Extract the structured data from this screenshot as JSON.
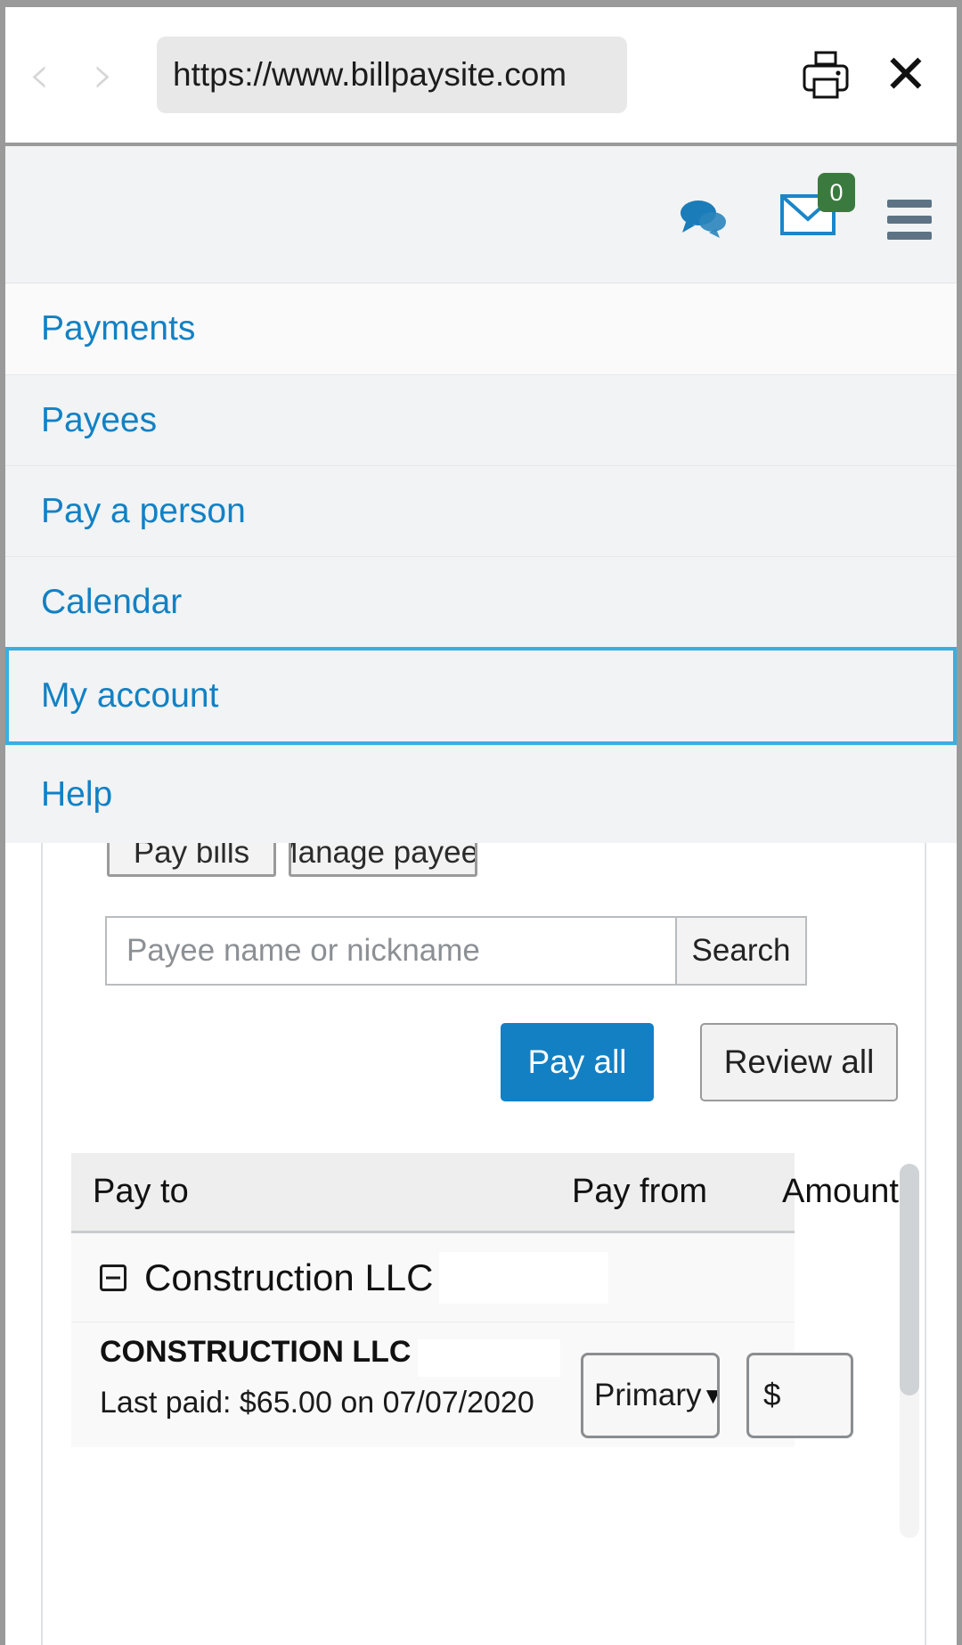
{
  "browser": {
    "back_icon": "chevron-left-icon",
    "forward_icon": "chevron-right-icon",
    "url": "https://www.billpaysite.com",
    "print_icon": "printer-icon",
    "close_icon": "close-icon"
  },
  "utility_bar": {
    "chat_icon": "chat-bubbles-icon",
    "mail_icon": "envelope-icon",
    "mail_badge": "0",
    "menu_icon": "hamburger-menu-icon"
  },
  "nav": {
    "items": [
      {
        "label": "Payments",
        "selected": false
      },
      {
        "label": "Payees",
        "selected": false
      },
      {
        "label": "Pay a person",
        "selected": false
      },
      {
        "label": "Calendar",
        "selected": false
      },
      {
        "label": "My account",
        "selected": true
      },
      {
        "label": "Help",
        "selected": false
      }
    ]
  },
  "tabs": [
    {
      "label": "Pay bills"
    },
    {
      "label": "Manage payees"
    }
  ],
  "search": {
    "placeholder": "Payee name or nickname",
    "value": "",
    "button_label": "Search"
  },
  "actions": {
    "pay_all_label": "Pay all",
    "review_all_label": "Review all"
  },
  "table": {
    "headers": {
      "pay_to": "Pay to",
      "pay_from": "Pay from",
      "amount": "Amount"
    },
    "groups": [
      {
        "collapse_icon": "minus-square-icon",
        "name": "Construction LLC",
        "rows": [
          {
            "payee_name": "CONSTRUCTION LLC",
            "last_paid": "Last paid: $65.00 on 07/07/2020",
            "pay_from": "Primary",
            "pay_from_caret": "▼",
            "amount": "$"
          }
        ]
      }
    ]
  },
  "colors": {
    "link_blue": "#1281c4",
    "primary_blue": "#1380c4",
    "selected_border": "#3aaee0",
    "badge_green": "#3a7a3f",
    "chrome_gray": "#9a9a9a"
  }
}
